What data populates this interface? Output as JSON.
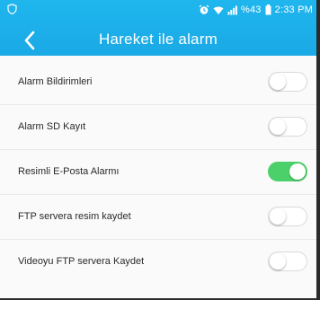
{
  "status_bar": {
    "battery_text": "%43",
    "time": "2:33 PM",
    "icons": [
      "shield-icon",
      "alarm-clock-icon",
      "wifi-icon",
      "signal-icon",
      "battery-icon"
    ]
  },
  "header": {
    "title": "Hareket ile alarm",
    "back_icon": "chevron-left-icon",
    "background": "#1fb6ee"
  },
  "settings": [
    {
      "label": "Alarm Bildirimleri",
      "enabled": false
    },
    {
      "label": "Alarm SD Kayıt",
      "enabled": false
    },
    {
      "label": "Resimli E-Posta Alarmı",
      "enabled": true
    },
    {
      "label": "FTP servera resim kaydet",
      "enabled": false
    },
    {
      "label": "Videoyu FTP servera Kaydet",
      "enabled": false
    }
  ],
  "colors": {
    "accent": "#1fb6ee",
    "toggle_on": "#4cd06a",
    "toggle_off_border": "#d9d9d9"
  }
}
